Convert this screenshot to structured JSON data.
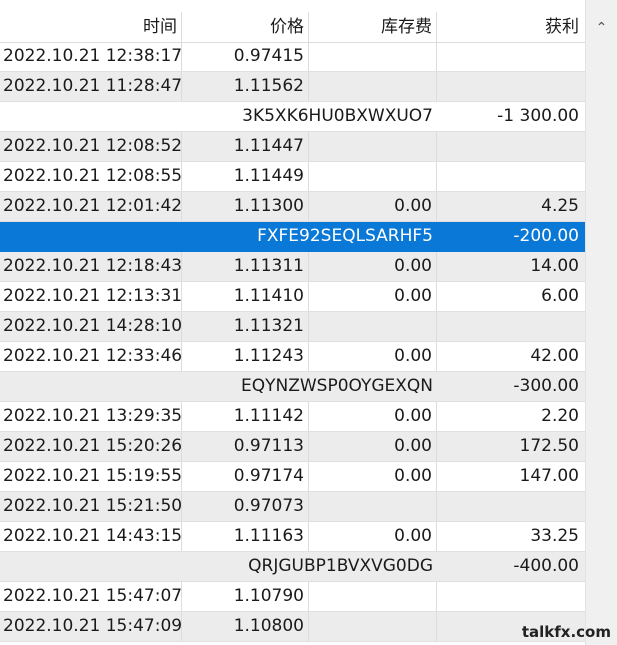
{
  "columns": {
    "time": "时间",
    "price": "价格",
    "swap": "库存费",
    "profit": "获利"
  },
  "rows": [
    {
      "time": "2022.10.21 12:38:17",
      "price": "0.97415",
      "swap": "",
      "profit": "",
      "style": "white"
    },
    {
      "time": "2022.10.21 11:28:47",
      "price": "1.11562",
      "swap": "",
      "profit": "",
      "style": "gray"
    },
    {
      "label": "3K5XK6HU0BXWXUO7",
      "profit": "-1 300.00",
      "style": "white"
    },
    {
      "time": "2022.10.21 12:08:52",
      "price": "1.11447",
      "swap": "",
      "profit": "",
      "style": "gray"
    },
    {
      "time": "2022.10.21 12:08:55",
      "price": "1.11449",
      "swap": "",
      "profit": "",
      "style": "white"
    },
    {
      "time": "2022.10.21 12:01:42",
      "price": "1.11300",
      "swap": "0.00",
      "profit": "4.25",
      "style": "gray"
    },
    {
      "label": "FXFE92SEQLSARHF5",
      "profit": "-200.00",
      "style": "sel"
    },
    {
      "time": "2022.10.21 12:18:43",
      "price": "1.11311",
      "swap": "0.00",
      "profit": "14.00",
      "style": "gray"
    },
    {
      "time": "2022.10.21 12:13:31",
      "price": "1.11410",
      "swap": "0.00",
      "profit": "6.00",
      "style": "white"
    },
    {
      "time": "2022.10.21 14:28:10",
      "price": "1.11321",
      "swap": "",
      "profit": "",
      "style": "gray"
    },
    {
      "time": "2022.10.21 12:33:46",
      "price": "1.11243",
      "swap": "0.00",
      "profit": "42.00",
      "style": "white"
    },
    {
      "label": "EQYNZWSP0OYGEXQN",
      "profit": "-300.00",
      "style": "gray"
    },
    {
      "time": "2022.10.21 13:29:35",
      "price": "1.11142",
      "swap": "0.00",
      "profit": "2.20",
      "style": "white"
    },
    {
      "time": "2022.10.21 15:20:26",
      "price": "0.97113",
      "swap": "0.00",
      "profit": "172.50",
      "style": "gray"
    },
    {
      "time": "2022.10.21 15:19:55",
      "price": "0.97174",
      "swap": "0.00",
      "profit": "147.00",
      "style": "white"
    },
    {
      "time": "2022.10.21 15:21:50",
      "price": "0.97073",
      "swap": "",
      "profit": "",
      "style": "gray"
    },
    {
      "time": "2022.10.21 14:43:15",
      "price": "1.11163",
      "swap": "0.00",
      "profit": "33.25",
      "style": "white"
    },
    {
      "label": "QRJGUBP1BVXVG0DG",
      "profit": "-400.00",
      "style": "gray"
    },
    {
      "time": "2022.10.21 15:47:07",
      "price": "1.10790",
      "swap": "",
      "profit": "",
      "style": "white"
    },
    {
      "time": "2022.10.21 15:47:09",
      "price": "1.10800",
      "swap": "",
      "profit": "",
      "style": "gray"
    }
  ],
  "scrollbar": {
    "up_icon": "chevron-up-icon"
  },
  "watermark": "talkfx.com"
}
